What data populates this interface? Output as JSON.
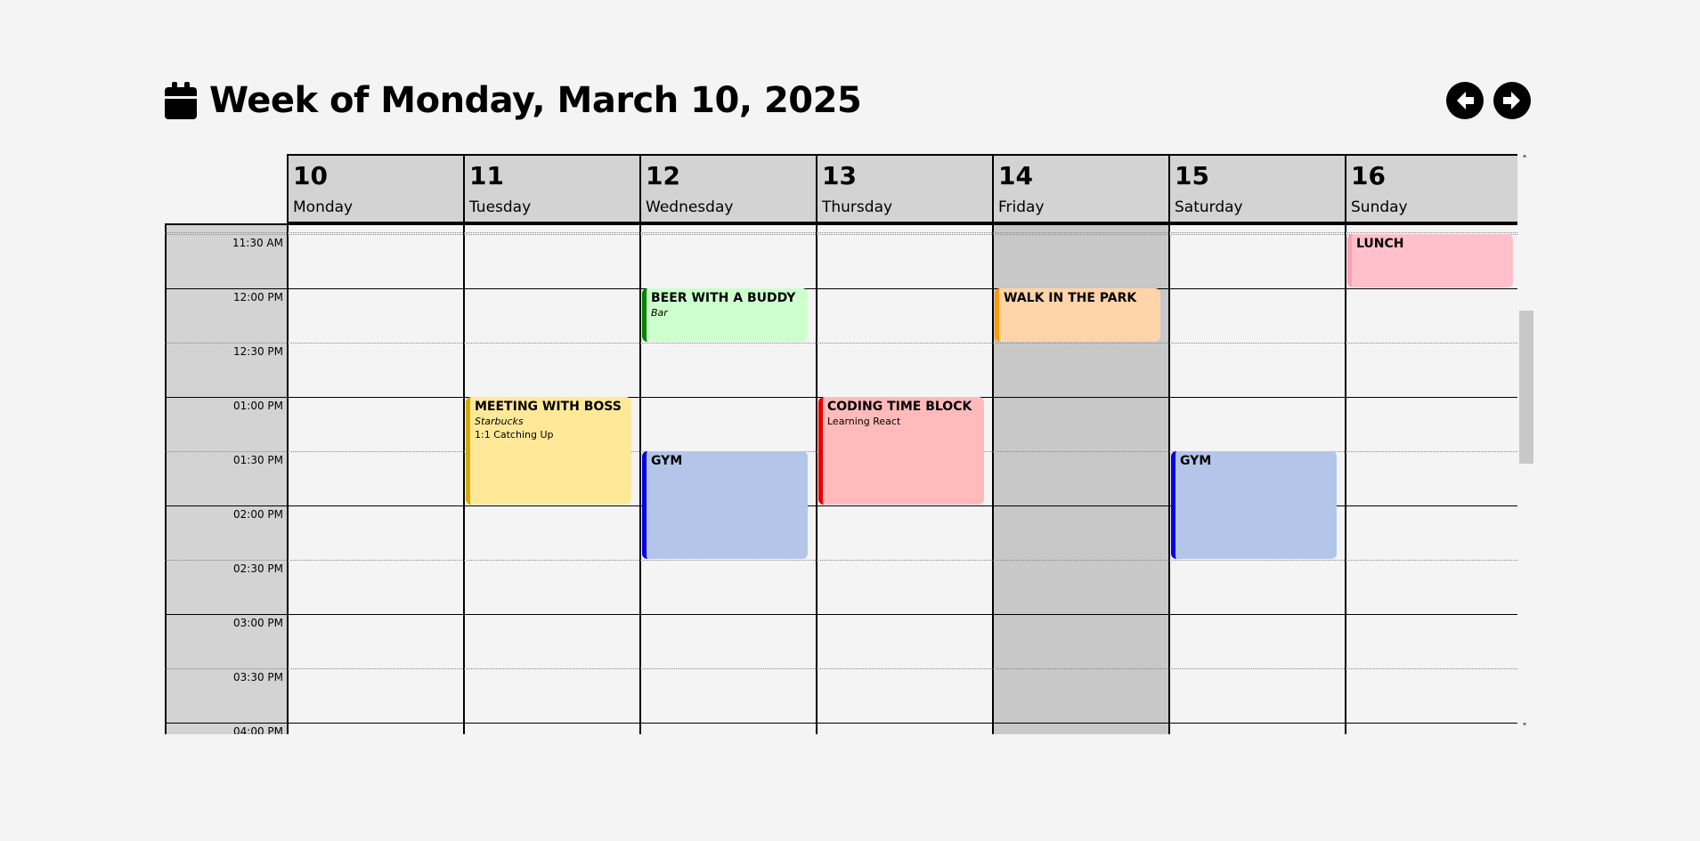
{
  "header": {
    "title": "Week of Monday, March 10, 2025",
    "icon": "calendar-icon"
  },
  "nav": {
    "prev_icon": "arrow-left-icon",
    "next_icon": "arrow-right-icon"
  },
  "days": [
    {
      "num": "10",
      "name": "Monday"
    },
    {
      "num": "11",
      "name": "Tuesday"
    },
    {
      "num": "12",
      "name": "Wednesday"
    },
    {
      "num": "13",
      "name": "Thursday"
    },
    {
      "num": "14",
      "name": "Friday"
    },
    {
      "num": "15",
      "name": "Saturday"
    },
    {
      "num": "16",
      "name": "Sunday"
    }
  ],
  "times": [
    "11:30 AM",
    "12:00 PM",
    "12:30 PM",
    "01:00 PM",
    "01:30 PM",
    "02:00 PM",
    "02:30 PM",
    "03:00 PM",
    "03:30 PM",
    "04:00 PM"
  ],
  "events": [
    {
      "title": "LUNCH",
      "subtitle": "",
      "subtitle2": "",
      "day": 6,
      "start": "11:30 AM",
      "end": "12:00 PM",
      "bg": "#ffc0cb",
      "accent": "#ff9fb3"
    },
    {
      "title": "BEER WITH A BUDDY",
      "subtitle": "Bar",
      "subtitle2": "",
      "day": 2,
      "start": "12:00 PM",
      "end": "12:30 PM",
      "bg": "#ccffcc",
      "accent": "#008000"
    },
    {
      "title": "WALK IN THE PARK",
      "subtitle": "",
      "subtitle2": "",
      "day": 4,
      "start": "12:00 PM",
      "end": "12:30 PM",
      "bg": "#ffd4a8",
      "accent": "#ff9900"
    },
    {
      "title": "MEETING WITH BOSS",
      "subtitle": "Starbucks",
      "subtitle2": "1:1 Catching Up",
      "day": 1,
      "start": "01:00 PM",
      "end": "02:00 PM",
      "bg": "#ffe999",
      "accent": "#d4a800"
    },
    {
      "title": "CODING TIME BLOCK",
      "subtitle": "",
      "subtitle2": "Learning React",
      "day": 3,
      "start": "01:00 PM",
      "end": "02:00 PM",
      "bg": "#ffbbbb",
      "accent": "#e60000"
    },
    {
      "title": "GYM",
      "subtitle": "",
      "subtitle2": "",
      "day": 2,
      "start": "01:30 PM",
      "end": "02:30 PM",
      "bg": "#b3c6ea",
      "accent": "#0000ee"
    },
    {
      "title": "GYM",
      "subtitle": "",
      "subtitle2": "",
      "day": 5,
      "start": "01:30 PM",
      "end": "02:30 PM",
      "bg": "#b3c6ea",
      "accent": "#0000ee"
    }
  ]
}
